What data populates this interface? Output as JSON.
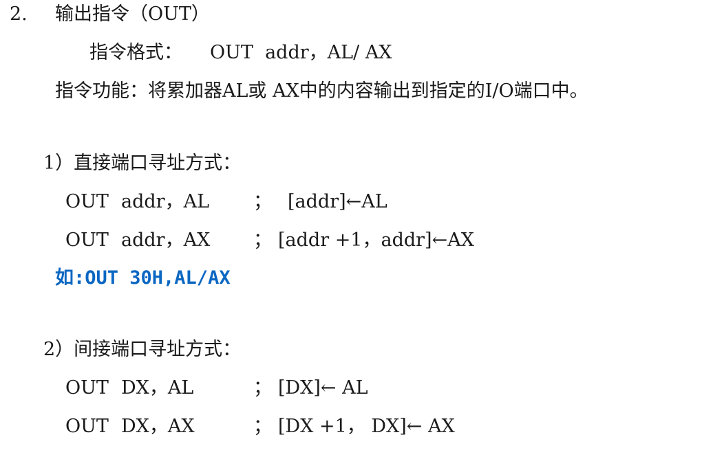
{
  "heading": {
    "number": "2.",
    "title": "输出指令（OUT）"
  },
  "format": {
    "label": "指令格式：",
    "value": "OUT  addr，AL/ AX"
  },
  "function": "指令功能：将累加器AL或 AX中的内容输出到指定的I/O端口中。",
  "direct": {
    "heading": "1）直接端口寻址方式：",
    "rows": [
      {
        "op": "OUT",
        "args": "addr，AL",
        "semi": "；",
        "comment": "[addr]←AL"
      },
      {
        "op": "OUT",
        "args": "addr，AX",
        "semi": "；",
        "comment": "[addr +1，addr]←AX"
      }
    ],
    "example": "如:OUT 30H,AL/AX"
  },
  "indirect": {
    "heading": "2）间接端口寻址方式：",
    "rows": [
      {
        "op": "OUT",
        "args": "DX，AL",
        "semi": "；",
        "comment": "[DX]← AL"
      },
      {
        "op": "OUT",
        "args": "DX，AX",
        "semi": "；",
        "comment": "[DX +1， DX]← AX"
      }
    ]
  },
  "colors": {
    "text": "#1a1a1a",
    "example": "#0b67c2"
  }
}
